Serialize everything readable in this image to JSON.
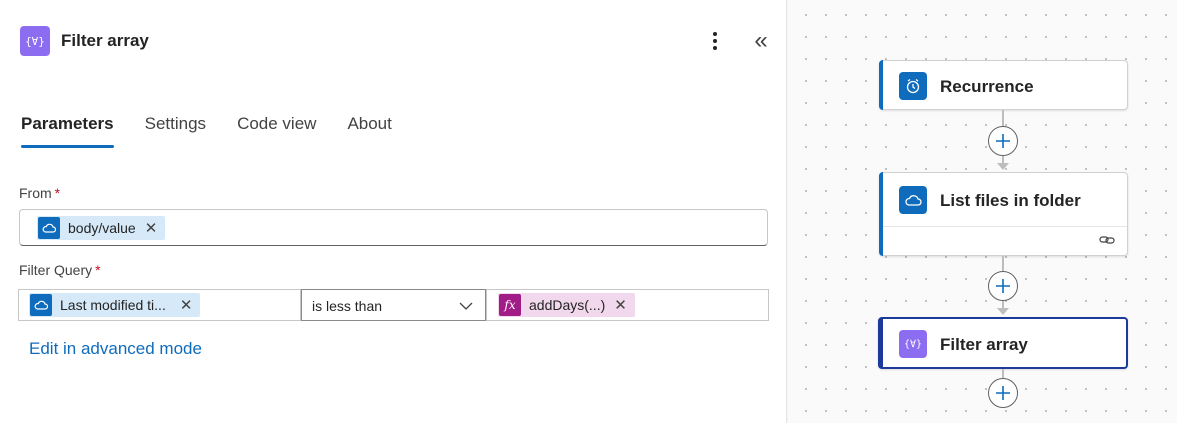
{
  "panel": {
    "title": "Filter array",
    "icon": "filter-array-icon",
    "icon_glyph": "{∀}",
    "collapse_glyph": "«",
    "tabs": [
      {
        "label": "Parameters",
        "active": true
      },
      {
        "label": "Settings",
        "active": false
      },
      {
        "label": "Code view",
        "active": false
      },
      {
        "label": "About",
        "active": false
      }
    ],
    "from": {
      "label": "From",
      "required_mark": "*",
      "token": "body/value",
      "token_icon": "onedrive-cloud-icon"
    },
    "filter_query": {
      "label": "Filter Query",
      "required_mark": "*",
      "left_token": "Last modified ti...",
      "operator": "is less than",
      "right_token": "addDays(...)",
      "right_token_glyph": "fx"
    },
    "advanced_link": "Edit in advanced mode",
    "close_glyph": "✕",
    "chevron_glyph": "﹀"
  },
  "canvas": {
    "nodes": [
      {
        "title": "Recurrence",
        "icon": "clock-icon",
        "accent": "#0f6cbd"
      },
      {
        "title": "List files in folder",
        "icon": "onedrive-cloud-icon",
        "accent": "#0f6cbd"
      },
      {
        "title": "Filter array",
        "icon": "filter-array-icon",
        "accent": "#8c6cf0",
        "selected": true
      }
    ],
    "add_glyph": "+"
  },
  "colors": {
    "primary": "#0f6cbd",
    "action_purple": "#8c6cf0",
    "expression": "#a11c86",
    "required": "#c50f1f"
  }
}
